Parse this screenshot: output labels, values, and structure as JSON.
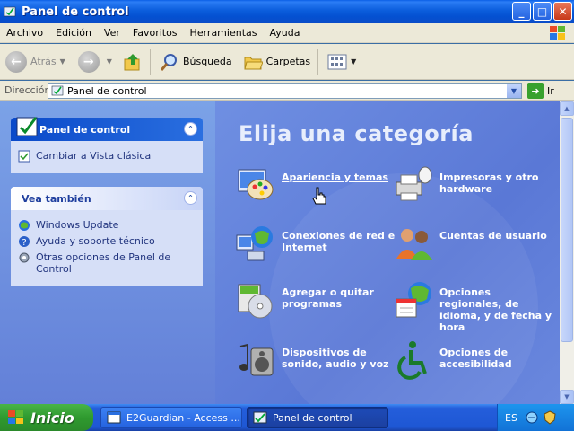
{
  "window": {
    "title": "Panel de control"
  },
  "menu": [
    "Archivo",
    "Edición",
    "Ver",
    "Favoritos",
    "Herramientas",
    "Ayuda"
  ],
  "toolbar": {
    "back": "Atrás",
    "search": "Búsqueda",
    "folders": "Carpetas"
  },
  "address": {
    "label": "Dirección",
    "value": "Panel de control",
    "go": "Ir"
  },
  "sidebar": {
    "panel1": {
      "title": "Panel de control",
      "links": [
        "Cambiar a Vista clásica"
      ]
    },
    "panel2": {
      "title": "Vea también",
      "links": [
        "Windows Update",
        "Ayuda y soporte técnico",
        "Otras opciones de Panel de Control"
      ]
    }
  },
  "main": {
    "heading": "Elija una categoría",
    "categories": [
      "Apariencia y temas",
      "Impresoras y otro hardware",
      "Conexiones de red e Internet",
      "Cuentas de usuario",
      "Agregar o quitar programas",
      "Opciones regionales, de idioma, y de fecha y hora",
      "Dispositivos de sonido, audio y voz",
      "Opciones de accesibilidad"
    ]
  },
  "taskbar": {
    "start": "Inicio",
    "tasks": [
      "E2Guardian - Access ...",
      "Panel de control"
    ],
    "lang": "ES"
  },
  "colors": {
    "titlebar": "#0a5fe6",
    "sidebar": "#7ba2e7",
    "content": "#6b8ae0",
    "start": "#3ea33e"
  }
}
